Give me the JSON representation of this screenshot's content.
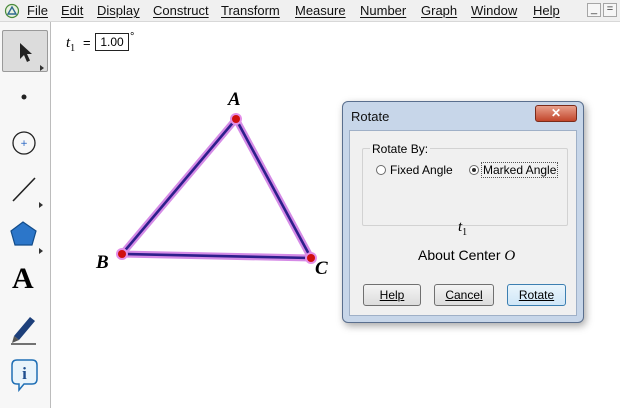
{
  "menu": {
    "items": [
      "File",
      "Edit",
      "Display",
      "Construct",
      "Transform",
      "Measure",
      "Number",
      "Graph",
      "Window",
      "Help"
    ]
  },
  "window_controls": {
    "minimize": "_",
    "restore": "="
  },
  "toolbox": {
    "tools": [
      "selection-arrow",
      "point",
      "compass",
      "straightedge",
      "polygon",
      "text",
      "marker",
      "information"
    ],
    "text_tool_label": "A",
    "selected": "selection-arrow"
  },
  "parameter": {
    "name": "t",
    "subscript": "1",
    "equals": "=",
    "value": "1.00",
    "unit": "°"
  },
  "triangle": {
    "labels": {
      "A": "A",
      "B": "B",
      "C": "C"
    },
    "colors": {
      "stroke": "#2e1f8c",
      "highlight": "#d58be6",
      "point": "#d01010"
    }
  },
  "dialog": {
    "title": "Rotate",
    "close_label": "✕",
    "group_title": "Rotate By:",
    "options": {
      "fixed_angle": "Fixed Angle",
      "marked_angle": "Marked Angle",
      "selected": "marked_angle"
    },
    "angle_name": "t",
    "angle_subscript": "1",
    "about_center_text": "About Center",
    "center_name": "O",
    "buttons": {
      "help": "Help",
      "cancel": "Cancel",
      "rotate": "Rotate"
    }
  }
}
